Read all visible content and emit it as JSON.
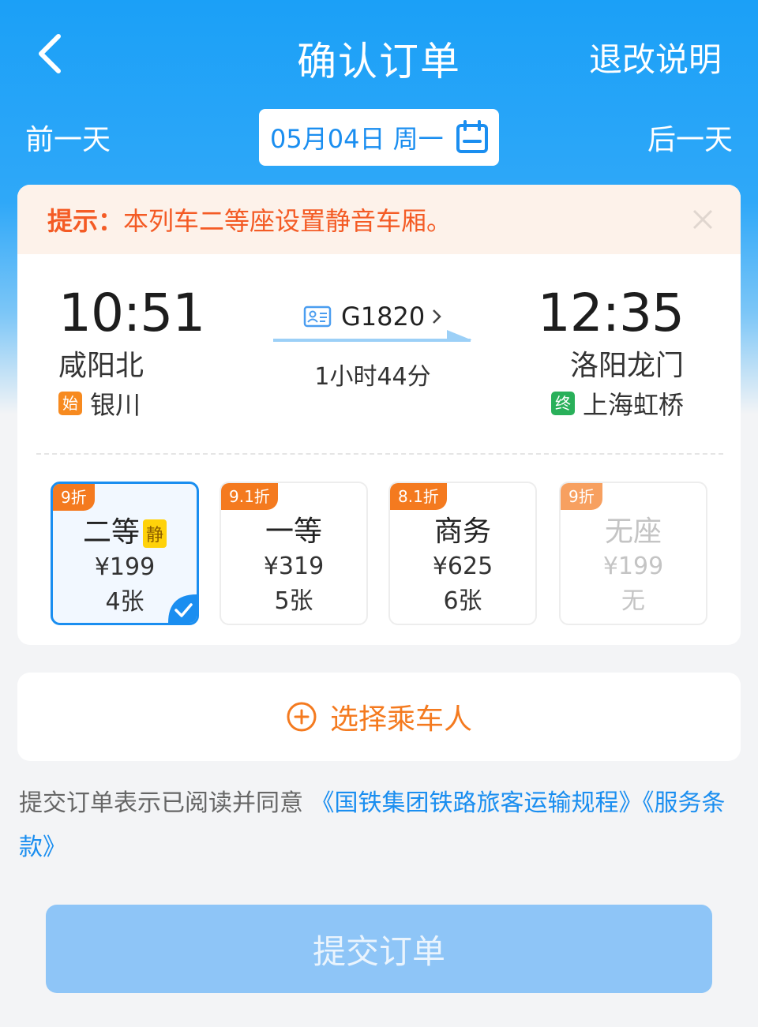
{
  "header": {
    "title": "确认订单",
    "refund_label": "退改说明",
    "prev_day": "前一天",
    "next_day": "后一天",
    "date": "05月04日 周一"
  },
  "notice": {
    "label": "提示：",
    "text": "本列车二等座设置静音车厢。"
  },
  "trip": {
    "departure_time": "10:51",
    "departure_station": "咸阳北",
    "origin_tag": "始",
    "origin": "银川",
    "train_no": "G1820",
    "duration": "1小时44分",
    "arrival_time": "12:35",
    "arrival_station": "洛阳龙门",
    "terminal_tag": "终",
    "terminal": "上海虹桥"
  },
  "seats": [
    {
      "discount": "9折",
      "name": "二等",
      "tag": "静",
      "price": "¥199",
      "count": "4张"
    },
    {
      "discount": "9.1折",
      "name": "一等",
      "price": "¥319",
      "count": "5张"
    },
    {
      "discount": "8.1折",
      "name": "商务",
      "price": "¥625",
      "count": "6张"
    },
    {
      "discount": "9折",
      "name": "无座",
      "price": "¥199",
      "count": "无"
    }
  ],
  "passenger": {
    "label": "选择乘车人"
  },
  "agreement": {
    "prefix": "提交订单表示已阅读并同意 ",
    "link1": "《国铁集团铁路旅客运输规程》",
    "link2": "《服务条款》"
  },
  "submit_label": "提交订单",
  "colors": {
    "brand_blue": "#1a8ef0",
    "accent_orange": "#f47a1f",
    "notice_red": "#f45b25",
    "terminal_green": "#29b05a"
  }
}
